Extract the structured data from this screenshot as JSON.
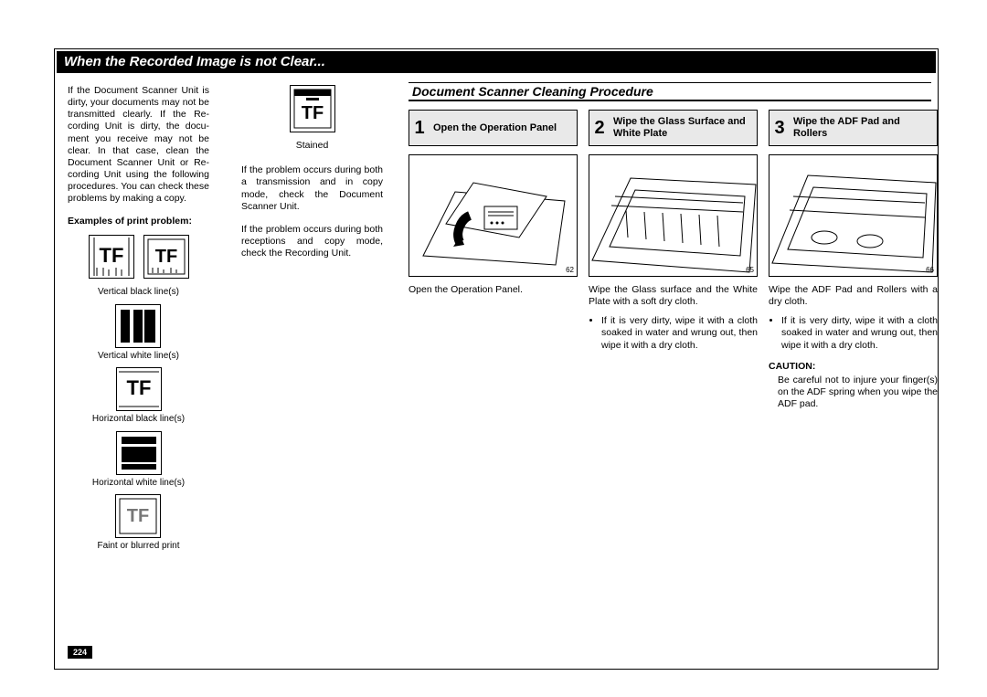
{
  "page_number": "224",
  "title": "When the Recorded Image is not Clear...",
  "intro": "If the Document Scanner Unit is dirty, your documents may not be transmitted clearly. If the Re-cording Unit is dirty, the docu-ment you receive may not be clear.  In that case, clean the Document Scanner Unit or Re-cording Unit using the following procedures. You can check these problems by making a copy.",
  "examples_header": "Examples of print problem:",
  "examples": {
    "tf_glyph": "TF",
    "vbl": "Vertical black line(s)",
    "vwl": "Vertical white line(s)",
    "hbl": "Horizontal black line(s)",
    "hwl": "Horizontal white line(s)",
    "faint": "Faint or blurred print",
    "stained": "Stained"
  },
  "col2_p1": "If the problem occurs during both a transmission and in copy mode, check the Document Scanner Unit.",
  "col2_p2": "If the problem occurs during both receptions and copy mode, check the Recording Unit.",
  "section_header": "Document Scanner Cleaning Procedure",
  "steps": {
    "s1": {
      "num": "1",
      "title": "Open the Operation Panel",
      "fig_num": "62",
      "body": "Open the Operation Panel."
    },
    "s2": {
      "num": "2",
      "title": "Wipe the Glass Surface and White Plate",
      "fig_num": "65",
      "body": "Wipe the Glass surface and the White Plate with a soft dry cloth.",
      "bullet1": "If it is very dirty, wipe it with a cloth soaked in water and wrung out, then wipe it with a dry cloth."
    },
    "s3": {
      "num": "3",
      "title": "Wipe the ADF Pad and Rollers",
      "fig_num": "66",
      "body": "Wipe the ADF Pad and Rollers with a dry cloth.",
      "bullet1": "If it is very dirty, wipe it with a cloth soaked in water and wrung out, then wipe it with a dry cloth.",
      "caution_head": "CAUTION:",
      "caution_body": "Be careful not to injure your finger(s) on the ADF spring when you wipe the ADF pad."
    }
  }
}
